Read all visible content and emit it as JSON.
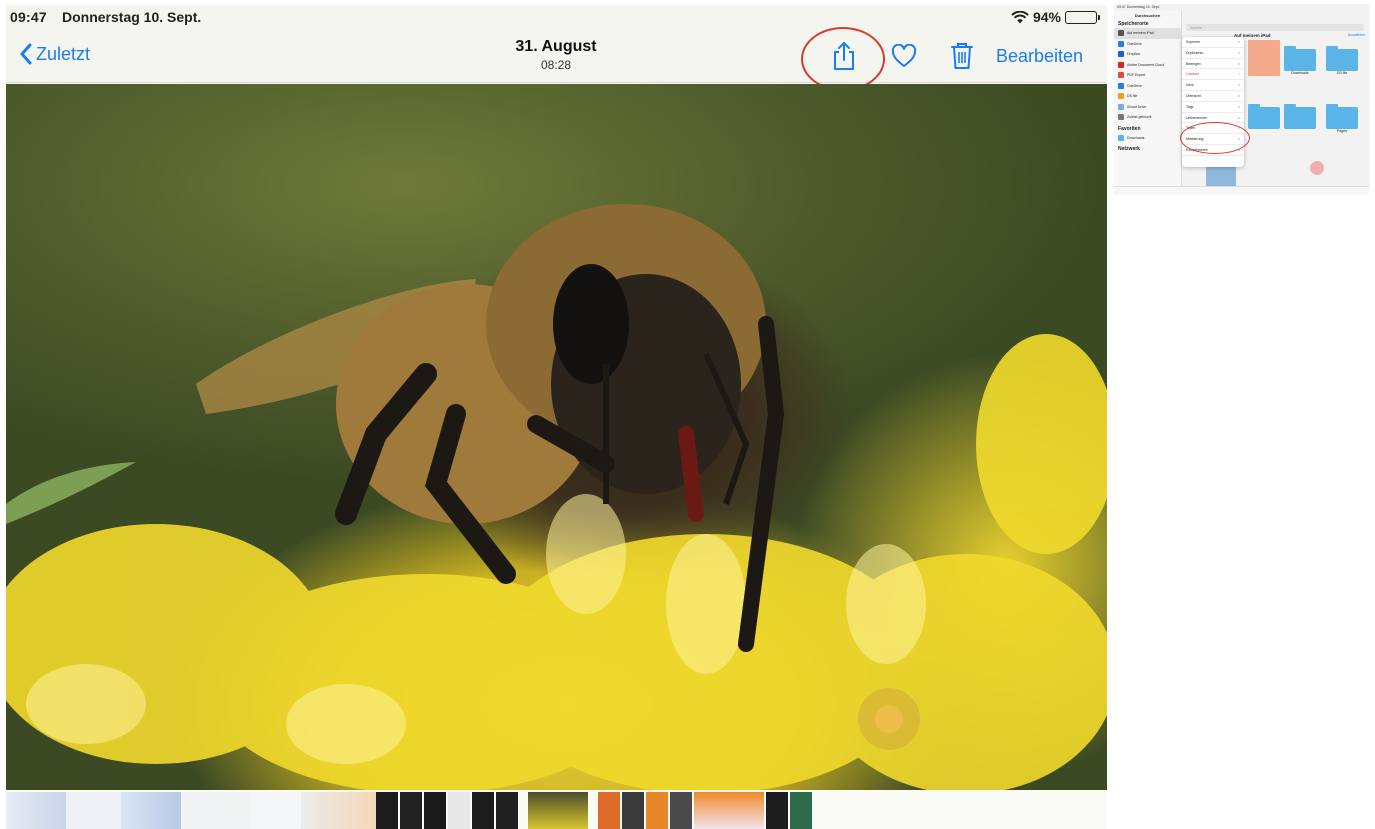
{
  "status_bar": {
    "time": "09:47",
    "date": "Donnerstag 10. Sept.",
    "battery": "94%",
    "battery_level": 0.94
  },
  "nav": {
    "back_label": "Zuletzt",
    "title": "31. August",
    "subtitle": "08:28",
    "edit_label": "Bearbeiten"
  },
  "icons": {
    "back": "chevron-left-icon",
    "share": "share-icon",
    "favorite": "heart-icon",
    "delete": "trash-icon",
    "wifi": "wifi-icon",
    "battery": "battery-icon",
    "assistive_touch": "assistive-touch-icon"
  },
  "colors": {
    "accent": "#1a7cf2",
    "highlight_circle": "#d93a2b",
    "menu_destructive": "#e0352b"
  },
  "inset": {
    "status_time": "09:47",
    "status_date": "Donnerstag 10. Sept.",
    "sidebar_title": "Durchsuchen",
    "sections": {
      "locations": "Speicherorte",
      "favorites": "Favoriten",
      "network": "Netzwerk"
    },
    "sidebar_items": [
      {
        "label": "Auf meinem iPad",
        "color": "#555555"
      },
      {
        "label": "OneDrive",
        "color": "#2a7be4"
      },
      {
        "label": "Dropbox",
        "color": "#1f5fd6"
      },
      {
        "label": "Adobe Document Cloud",
        "color": "#d7261d"
      },
      {
        "label": "PDF Expert",
        "color": "#e24a3a"
      },
      {
        "label": "OneDrive",
        "color": "#2a7be4"
      },
      {
        "label": "DS file",
        "color": "#f0a020"
      },
      {
        "label": "iCloud Drive",
        "color": "#7aa8e8"
      },
      {
        "label": "Zuletzt gelöscht",
        "color": "#777777"
      }
    ],
    "favorite_items": [
      "Downloads"
    ],
    "search_placeholder": "Suchen",
    "main_title": "Auf meinem iPad",
    "choose_label": "Auswählen",
    "menu_items": [
      {
        "label": "Kopieren",
        "destructive": false
      },
      {
        "label": "Duplizieren",
        "destructive": false
      },
      {
        "label": "Bewegen",
        "destructive": false
      },
      {
        "label": "Löschen",
        "destructive": true
      },
      {
        "label": "Infos",
        "destructive": false
      },
      {
        "label": "Übersicht",
        "destructive": false
      },
      {
        "label": "Tags",
        "destructive": false
      },
      {
        "label": "Umbenennen",
        "destructive": false
      },
      {
        "label": "Teilen",
        "destructive": false
      },
      {
        "label": "Markierung",
        "destructive": false
      },
      {
        "label": "Komprimieren",
        "destructive": false
      }
    ],
    "files": [
      {
        "name": "Downloads"
      },
      {
        "name": "DS file"
      },
      {
        "name": "Pages"
      }
    ]
  }
}
